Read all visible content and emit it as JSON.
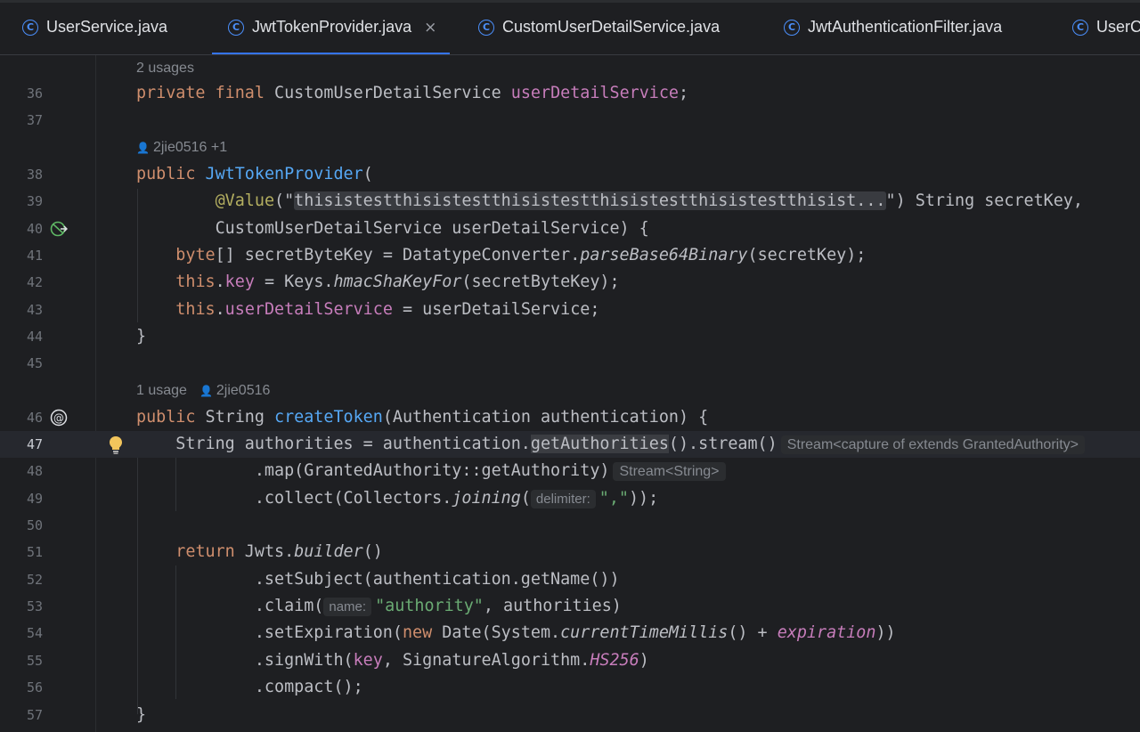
{
  "tabs": [
    {
      "name": "UserService.java",
      "active": false
    },
    {
      "name": "JwtTokenProvider.java",
      "active": true,
      "close": "×"
    },
    {
      "name": "CustomUserDetailService.java",
      "active": false
    },
    {
      "name": "JwtAuthenticationFilter.java",
      "active": false
    },
    {
      "name": "UserC",
      "active": false
    }
  ],
  "tab_icon_letter": "C",
  "hints": {
    "usages_field": "2 usages",
    "author_ctor": "2jie0516 +1",
    "usages_method": "1 usage",
    "author_method": "2jie0516"
  },
  "line_numbers": [
    "36",
    "37",
    "38",
    "39",
    "40",
    "41",
    "42",
    "43",
    "44",
    "45",
    "46",
    "47",
    "48",
    "49",
    "50",
    "51",
    "52",
    "53",
    "54",
    "55",
    "56",
    "57"
  ],
  "code": {
    "l36": {
      "a": "private",
      "b": " ",
      "c": "final",
      "d": " CustomUserDetailService ",
      "e": "userDetailService",
      "f": ";"
    },
    "l38": {
      "a": "public",
      "b": " ",
      "c": "JwtTokenProvider",
      "d": "("
    },
    "l39": {
      "indent": "        ",
      "a": "@Value",
      "b": "(\"",
      "c": "thisistestthisistestthisistestthisistestthisistestthisist...",
      "d": "\"",
      "e": ") String secretKey,"
    },
    "l40": {
      "a": "        CustomUserDetailService userDetailService) {"
    },
    "l41": {
      "indent": "    ",
      "a": "byte",
      "b": "[] secretByteKey = DatatypeConverter.",
      "c": "parseBase64Binary",
      "d": "(secretKey);"
    },
    "l42": {
      "indent": "    ",
      "a": "this",
      "b": ".",
      "c": "key",
      "d": " = Keys.",
      "e": "hmacShaKeyFor",
      "f": "(secretByteKey);"
    },
    "l43": {
      "indent": "    ",
      "a": "this",
      "b": ".",
      "c": "userDetailService",
      "d": " = userDetailService;"
    },
    "l44": {
      "a": "}"
    },
    "l46": {
      "a": "public",
      "b": " String ",
      "c": "createToken",
      "d": "(Authentication authentication) {"
    },
    "l47": {
      "a": "    String authorities = authentication.",
      "b": "getAuthorities",
      "c": "().stream()",
      "inlay": "Stream<capture of extends GrantedAuthority>"
    },
    "l48": {
      "a": "            .map(GrantedAuthority::getAuthority)",
      "inlay": "Stream<String>"
    },
    "l49": {
      "a": "            .collect(Collectors.",
      "b": "joining",
      "c": "(",
      "param": "delimiter:",
      "d": "\",\"",
      "e": "));"
    },
    "l51": {
      "indent": "    ",
      "a": "return",
      "b": " Jwts.",
      "c": "builder",
      "d": "()"
    },
    "l52": {
      "a": "            .setSubject(authentication.getName())"
    },
    "l53": {
      "a": "            .claim(",
      "param": "name:",
      "b": "\"authority\"",
      "c": ", authorities)"
    },
    "l54": {
      "a": "            .setExpiration(",
      "b": "new",
      "c": " Date(System.",
      "d": "currentTimeMillis",
      "e": "() + ",
      "f": "expiration",
      "g": "))"
    },
    "l55": {
      "a": "            .signWith(",
      "b": "key",
      "c": ", SignatureAlgorithm.",
      "d": "HS256",
      "e": ")"
    },
    "l56": {
      "a": "            .compact();"
    },
    "l57": {
      "a": "}"
    }
  },
  "colors": {
    "background": "#1e1f22",
    "keyword": "#cf8e6d",
    "field": "#c77dbb",
    "function": "#56a8f5",
    "string": "#6aab73",
    "annotation": "#b3ae60",
    "tab_accent": "#3574f0"
  },
  "icons": {
    "tab": "java-class-icon",
    "line40": "implementation-gutter-icon",
    "line46": "endpoint-at-gutter-icon",
    "line47": "lightbulb-icon"
  }
}
